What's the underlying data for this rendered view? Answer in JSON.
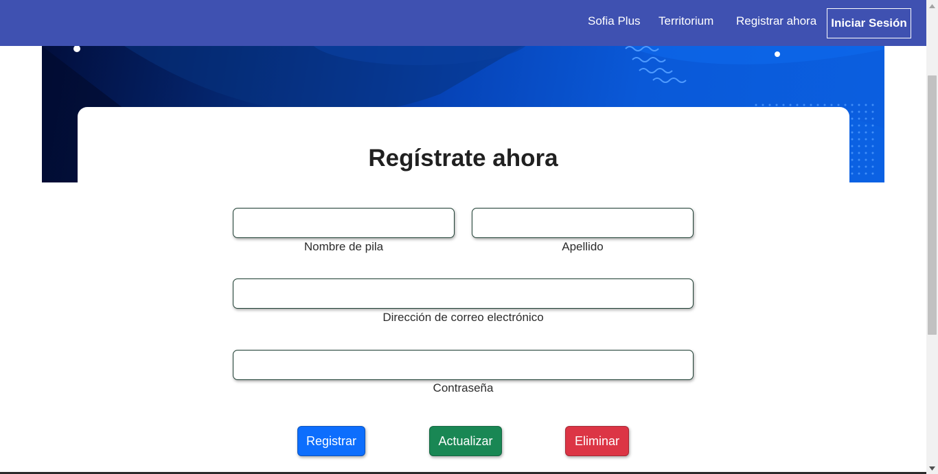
{
  "navbar": {
    "links": [
      {
        "label": "Sofia Plus"
      },
      {
        "label": "Territorium"
      },
      {
        "label": "Registrar ahora"
      }
    ],
    "login_label": "Iniciar Sesión",
    "background": "#3f51b1"
  },
  "hero": {
    "gradient_colors": [
      "#020e3c",
      "#04266f",
      "#0644b8",
      "#0b5fe0"
    ]
  },
  "form": {
    "title": "Regístrate ahora",
    "fields": {
      "first_name": {
        "label": "Nombre de pila",
        "value": ""
      },
      "last_name": {
        "label": "Apellido",
        "value": ""
      },
      "email": {
        "label": "Dirección de correo electrónico",
        "value": ""
      },
      "password": {
        "label": "Contraseña",
        "value": ""
      }
    },
    "buttons": {
      "register": {
        "label": "Registrar",
        "color": "#0d6efd"
      },
      "update": {
        "label": "Actualizar",
        "color": "#198754"
      },
      "delete": {
        "label": "Eliminar",
        "color": "#dc3545"
      }
    }
  }
}
